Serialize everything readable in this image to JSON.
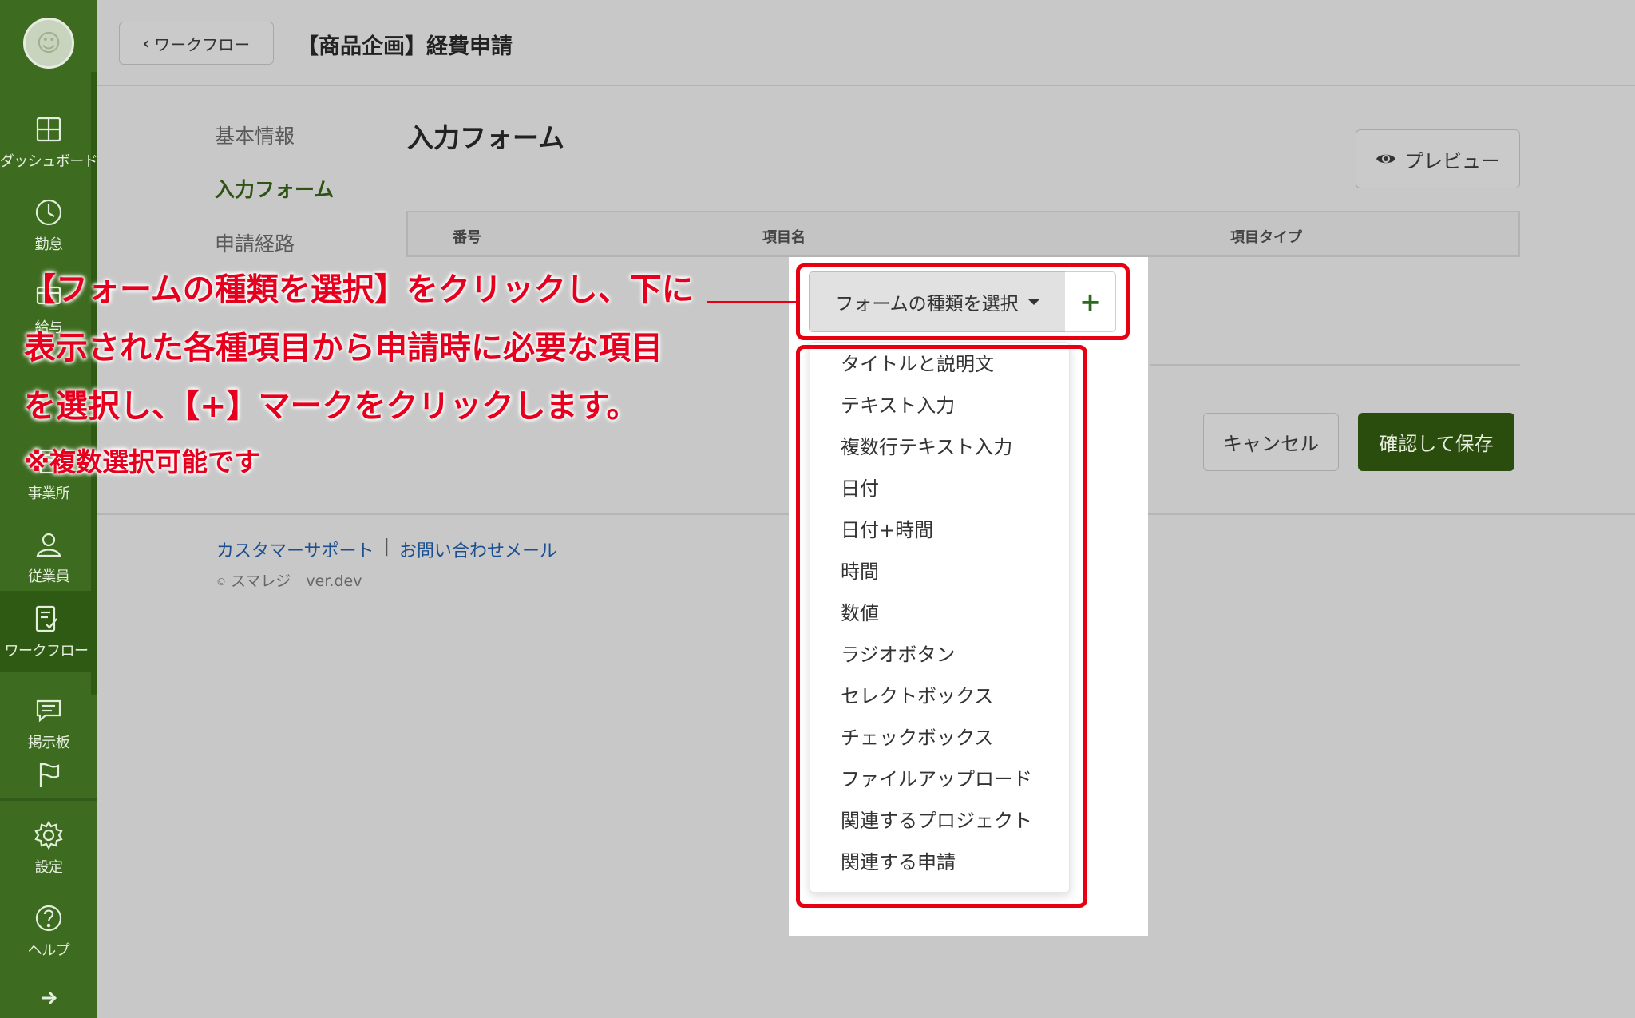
{
  "sidebar": {
    "items": [
      {
        "label": "ダッシュボード",
        "icon": "dashboard-icon"
      },
      {
        "label": "勤怠",
        "icon": "clock-icon"
      },
      {
        "label": "給与",
        "icon": "payroll-icon"
      },
      {
        "label": "事業所",
        "icon": "office-icon"
      },
      {
        "label": "従業員",
        "icon": "employee-icon"
      },
      {
        "label": "ワークフロー",
        "icon": "workflow-icon"
      },
      {
        "label": "掲示板",
        "icon": "message-board-icon"
      },
      {
        "label": "",
        "icon": "flag-icon"
      },
      {
        "label": "設定",
        "icon": "gear-icon"
      },
      {
        "label": "ヘルプ",
        "icon": "help-icon"
      }
    ],
    "active": "ワークフロー"
  },
  "header": {
    "back_label": "ワークフロー",
    "title": "【商品企画】経費申請"
  },
  "subnav": {
    "items": [
      "基本情報",
      "入力フォーム",
      "申請経路"
    ],
    "active": "入力フォーム"
  },
  "main": {
    "section_title": "入力フォーム",
    "preview_label": "プレビュー",
    "columns": [
      "番号",
      "項目名",
      "項目タイプ"
    ],
    "cancel_label": "キャンセル",
    "save_label": "確認して保存"
  },
  "dropdown": {
    "select_label": "フォームの種類を選択",
    "add_label": "+",
    "options": [
      "タイトルと説明文",
      "テキスト入力",
      "複数行テキスト入力",
      "日付",
      "日付+時間",
      "時間",
      "数値",
      "ラジオボタン",
      "セレクトボックス",
      "チェックボックス",
      "ファイルアップロード",
      "関連するプロジェクト",
      "関連する申請"
    ]
  },
  "footer": {
    "support_link": "カスタマーサポート",
    "separator": "|",
    "contact_link": "お問い合わせメール",
    "copyright_symbol": "©",
    "copyright": "スマレジ　ver.dev"
  },
  "annotation": {
    "line1": "【フォームの種類を選択】をクリックし、下に",
    "line2": "表示された各種項目から申請時に必要な項目",
    "line3": "を選択し、【+】マークをクリックします。",
    "note": "※複数選択可能です",
    "color": "#e60012"
  },
  "colors": {
    "sidebar": "#3d6b1f",
    "accent": "#2a4d0d",
    "link": "#1b4f8f"
  }
}
